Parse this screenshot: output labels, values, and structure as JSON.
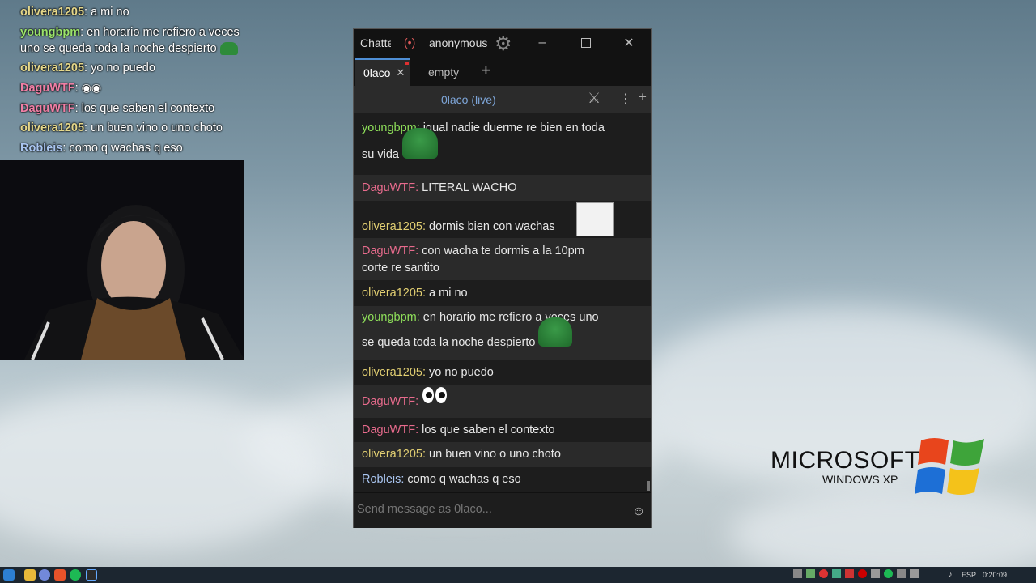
{
  "overlay_chat": [
    {
      "user": "olivera1205",
      "color": "#e6d88a",
      "text": "a mi no"
    },
    {
      "user": "youngbpm",
      "color": "#9be36a",
      "text": "en horario me refiero a veces",
      "text2": "uno se queda toda la noche despierto"
    },
    {
      "user": "olivera1205",
      "color": "#e6d88a",
      "text": "yo no puedo"
    },
    {
      "user": "DaguWTF",
      "color": "#f07fa5",
      "text": ""
    },
    {
      "user": "DaguWTF",
      "color": "#f07fa5",
      "text": "los que saben el contexto"
    },
    {
      "user": "olivera1205",
      "color": "#e6d88a",
      "text": "un buen vino o uno choto"
    },
    {
      "user": "Robleis",
      "color": "#a9c5f0",
      "text": "como q wachas q eso"
    }
  ],
  "window": {
    "title": "Chatte",
    "user": "anonymous",
    "tabs": [
      {
        "label": "0laco",
        "active": true
      },
      {
        "label": "empty",
        "active": false
      }
    ],
    "add_tab": "+",
    "channel_header": "0laco (live)",
    "input_placeholder": "Send message as 0laco..."
  },
  "messages": [
    {
      "user": "youngbpm",
      "color": "#8fe05a",
      "text": "igual nadie duerme re bien en toda",
      "text2": "su vida",
      "emote": "pepe",
      "alt": false
    },
    {
      "user": "DaguWTF",
      "color": "#e86b8d",
      "text": "LITERAL WACHO",
      "alt": true
    },
    {
      "user": "olivera1205",
      "color": "#e2cf72",
      "text": "dormis bien con wachas",
      "emote": "cereal-guy",
      "alt": false
    },
    {
      "user": "DaguWTF",
      "color": "#e86b8d",
      "text": "con wacha te dormis a la 10pm",
      "text2": "corte re santito",
      "alt": true
    },
    {
      "user": "olivera1205",
      "color": "#e2cf72",
      "text": "a mi no",
      "alt": false
    },
    {
      "user": "youngbpm",
      "color": "#8fe05a",
      "text": "en horario me refiero a veces uno",
      "text2": "se queda toda la noche despierto",
      "emote": "pepe",
      "alt": true
    },
    {
      "user": "olivera1205",
      "color": "#e2cf72",
      "text": "yo no puedo",
      "alt": false
    },
    {
      "user": "DaguWTF",
      "color": "#e86b8d",
      "text": "",
      "emote": "eyes",
      "alt": true
    },
    {
      "user": "DaguWTF",
      "color": "#e86b8d",
      "text": "los que saben el contexto",
      "alt": false
    },
    {
      "user": "olivera1205",
      "color": "#e2cf72",
      "text": "un buen vino o uno choto",
      "alt": true
    },
    {
      "user": "Robleis",
      "color": "#a9c5f0",
      "text": "como q wachas q eso",
      "alt": false
    }
  ],
  "desktop_logo": {
    "line1": "MICROSOFT",
    "line2": "WINDOWS XP"
  },
  "taskbar": {
    "lang": "ESP",
    "time": "0:20:09"
  }
}
